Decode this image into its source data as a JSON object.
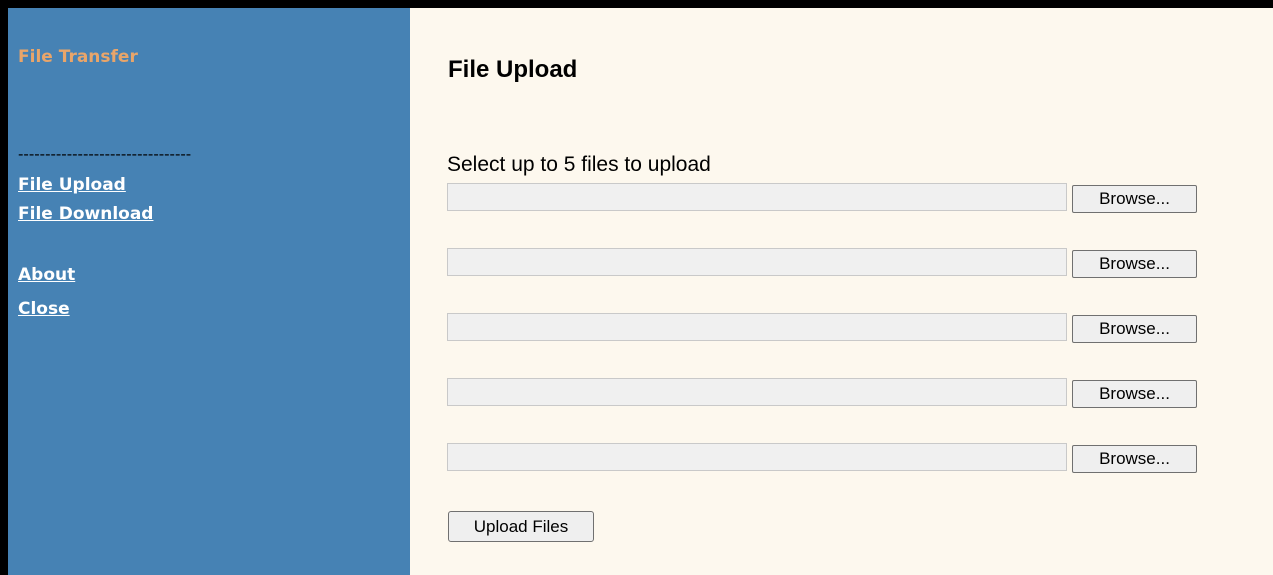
{
  "sidebar": {
    "app_title": "File Transfer",
    "divider": "--------------------------------",
    "nav": {
      "upload": "File Upload",
      "download": "File Download",
      "about": "About",
      "close": "Close"
    }
  },
  "main": {
    "title": "File Upload",
    "instructions": "Select up to 5 files to upload",
    "file_inputs": [
      {
        "value": "",
        "button": "Browse..."
      },
      {
        "value": "",
        "button": "Browse..."
      },
      {
        "value": "",
        "button": "Browse..."
      },
      {
        "value": "",
        "button": "Browse..."
      },
      {
        "value": "",
        "button": "Browse..."
      }
    ],
    "submit_label": "Upload Files"
  },
  "colors": {
    "sidebar_bg": "#4682b4",
    "app_title": "#e8a56a",
    "content_bg": "#fdf8ee",
    "frame": "#000000"
  }
}
